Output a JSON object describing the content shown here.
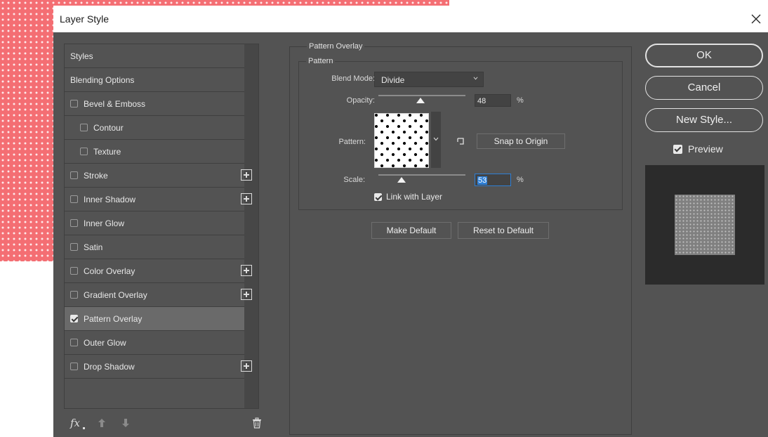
{
  "dialog": {
    "title": "Layer Style"
  },
  "styles_list": {
    "items": [
      {
        "label": "Styles",
        "has_checkbox": false,
        "checked": false,
        "indent": false,
        "has_plus": false,
        "selected": false
      },
      {
        "label": "Blending Options",
        "has_checkbox": false,
        "checked": false,
        "indent": false,
        "has_plus": false,
        "selected": false
      },
      {
        "label": "Bevel & Emboss",
        "has_checkbox": true,
        "checked": false,
        "indent": false,
        "has_plus": false,
        "selected": false
      },
      {
        "label": "Contour",
        "has_checkbox": true,
        "checked": false,
        "indent": true,
        "has_plus": false,
        "selected": false
      },
      {
        "label": "Texture",
        "has_checkbox": true,
        "checked": false,
        "indent": true,
        "has_plus": false,
        "selected": false
      },
      {
        "label": "Stroke",
        "has_checkbox": true,
        "checked": false,
        "indent": false,
        "has_plus": true,
        "selected": false
      },
      {
        "label": "Inner Shadow",
        "has_checkbox": true,
        "checked": false,
        "indent": false,
        "has_plus": true,
        "selected": false
      },
      {
        "label": "Inner Glow",
        "has_checkbox": true,
        "checked": false,
        "indent": false,
        "has_plus": false,
        "selected": false
      },
      {
        "label": "Satin",
        "has_checkbox": true,
        "checked": false,
        "indent": false,
        "has_plus": false,
        "selected": false
      },
      {
        "label": "Color Overlay",
        "has_checkbox": true,
        "checked": false,
        "indent": false,
        "has_plus": true,
        "selected": false
      },
      {
        "label": "Gradient Overlay",
        "has_checkbox": true,
        "checked": false,
        "indent": false,
        "has_plus": true,
        "selected": false
      },
      {
        "label": "Pattern Overlay",
        "has_checkbox": true,
        "checked": true,
        "indent": false,
        "has_plus": false,
        "selected": true
      },
      {
        "label": "Outer Glow",
        "has_checkbox": true,
        "checked": false,
        "indent": false,
        "has_plus": false,
        "selected": false
      },
      {
        "label": "Drop Shadow",
        "has_checkbox": true,
        "checked": false,
        "indent": false,
        "has_plus": true,
        "selected": false
      }
    ],
    "footer": {
      "fx_label": "fx",
      "icons": [
        "fx-menu-icon",
        "move-up-icon",
        "move-down-icon",
        "trash-icon"
      ]
    }
  },
  "pattern_overlay": {
    "group_title": "Pattern Overlay",
    "subgroup_title": "Pattern",
    "blend_mode_label": "Blend Mode:",
    "blend_mode_value": "Divide",
    "opacity_label": "Opacity:",
    "opacity_value": "48",
    "opacity_unit": "%",
    "opacity_fraction": 0.48,
    "pattern_label": "Pattern:",
    "snap_button_label": "Snap to Origin",
    "scale_label": "Scale:",
    "scale_value": "53",
    "scale_unit": "%",
    "scale_fraction": 0.27,
    "link_with_layer_label": "Link with Layer",
    "link_with_layer_checked": true,
    "make_default_label": "Make Default",
    "reset_default_label": "Reset to Default"
  },
  "actions": {
    "ok_label": "OK",
    "cancel_label": "Cancel",
    "new_style_label": "New Style...",
    "preview_label": "Preview",
    "preview_checked": true
  },
  "colors": {
    "dialog_bg": "#535353",
    "selected_row": "#6a6a6a",
    "focus_blue": "#2e7fd6",
    "canvas_pink": "#f46e73"
  }
}
